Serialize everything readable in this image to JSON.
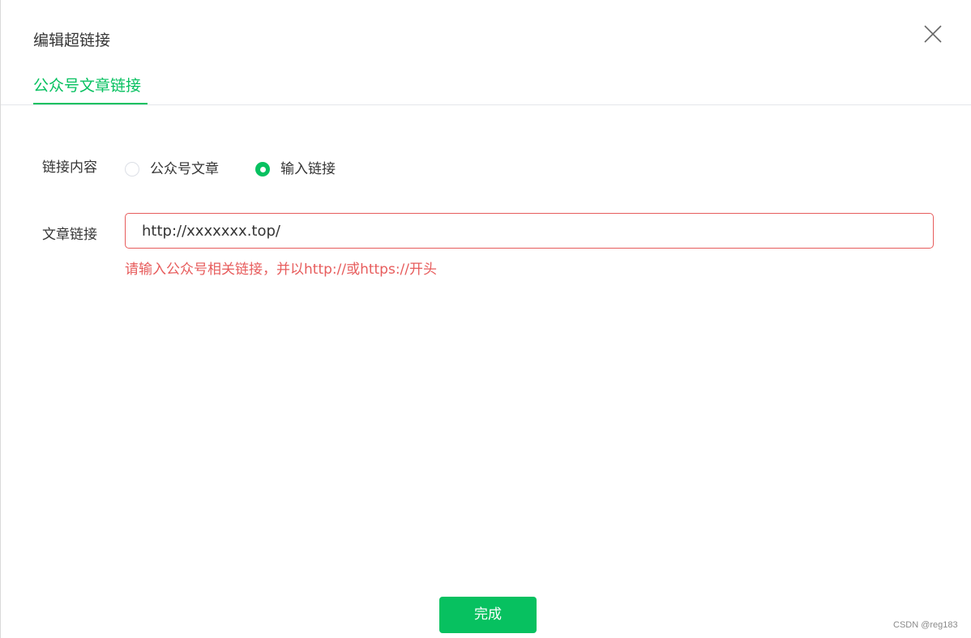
{
  "dialog": {
    "title": "编辑超链接",
    "close_icon": "close-icon"
  },
  "tabs": [
    {
      "label": "公众号文章链接",
      "active": true
    }
  ],
  "form": {
    "link_content": {
      "label": "链接内容",
      "options": [
        {
          "label": "公众号文章",
          "checked": false
        },
        {
          "label": "输入链接",
          "checked": true
        }
      ]
    },
    "article_link": {
      "label": "文章链接",
      "value": "http://xxxxxxx.top/",
      "error": "请输入公众号相关链接，并以http://或https://开头"
    }
  },
  "footer": {
    "done_label": "完成"
  },
  "watermark": "CSDN @reg183",
  "colors": {
    "accent": "#07c160",
    "error": "#e75c5c",
    "text": "#353535"
  }
}
